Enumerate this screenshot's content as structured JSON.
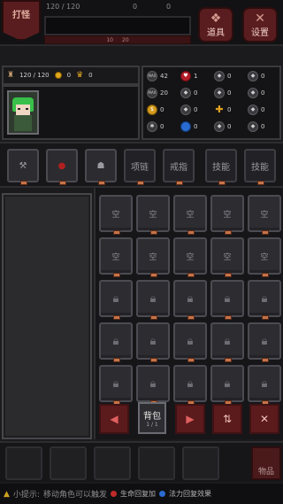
{
  "top": {
    "level_label": "打怪",
    "hp_text": "120 / 120",
    "gold_text": "0",
    "crown_text": "0",
    "mini_left": "10",
    "mini_right": "20",
    "props_label": "道具",
    "settings_label": "设置"
  },
  "stats": {
    "hp": "120 / 120",
    "gold": "0",
    "crown": "0"
  },
  "attributes": [
    {
      "icon": "MAX",
      "value": "42"
    },
    {
      "icon": "heart",
      "value": "1"
    },
    {
      "icon": "shield",
      "value": "0"
    },
    {
      "icon": "shield",
      "value": "0"
    },
    {
      "icon": "MAX",
      "value": "20"
    },
    {
      "icon": "shield",
      "value": "0"
    },
    {
      "icon": "shield",
      "value": "0"
    },
    {
      "icon": "shield",
      "value": "0"
    },
    {
      "icon": "gold",
      "value": "0"
    },
    {
      "icon": "shield",
      "value": "0"
    },
    {
      "icon": "cross",
      "value": "0"
    },
    {
      "icon": "shield",
      "value": "0"
    },
    {
      "icon": "gear",
      "value": "0"
    },
    {
      "icon": "orb",
      "value": "0"
    },
    {
      "icon": "shield",
      "value": "0"
    },
    {
      "icon": "shield",
      "value": "0"
    }
  ],
  "equipment": [
    {
      "label": "",
      "icon": "weapon-icon"
    },
    {
      "label": "",
      "icon": "armor-icon"
    },
    {
      "label": "",
      "icon": "helmet-icon"
    },
    {
      "label": "项链",
      "icon": ""
    },
    {
      "label": "戒指",
      "icon": ""
    },
    {
      "label": "技能",
      "icon": ""
    },
    {
      "label": "技能",
      "icon": ""
    }
  ],
  "inventory": {
    "empty_label": "空",
    "empty_cells": 10,
    "locked_cells": 15,
    "bag_label": "背包",
    "bag_page": "1 / 1",
    "prev": "◀",
    "next": "▶",
    "sort": "⇅",
    "close": "✕"
  },
  "bottom": {
    "items_label": "物品"
  },
  "hint": {
    "label": "小提示:",
    "text": "移动角色可以触发",
    "tag1": "生命回复加",
    "tag2": "法力回复效果"
  }
}
